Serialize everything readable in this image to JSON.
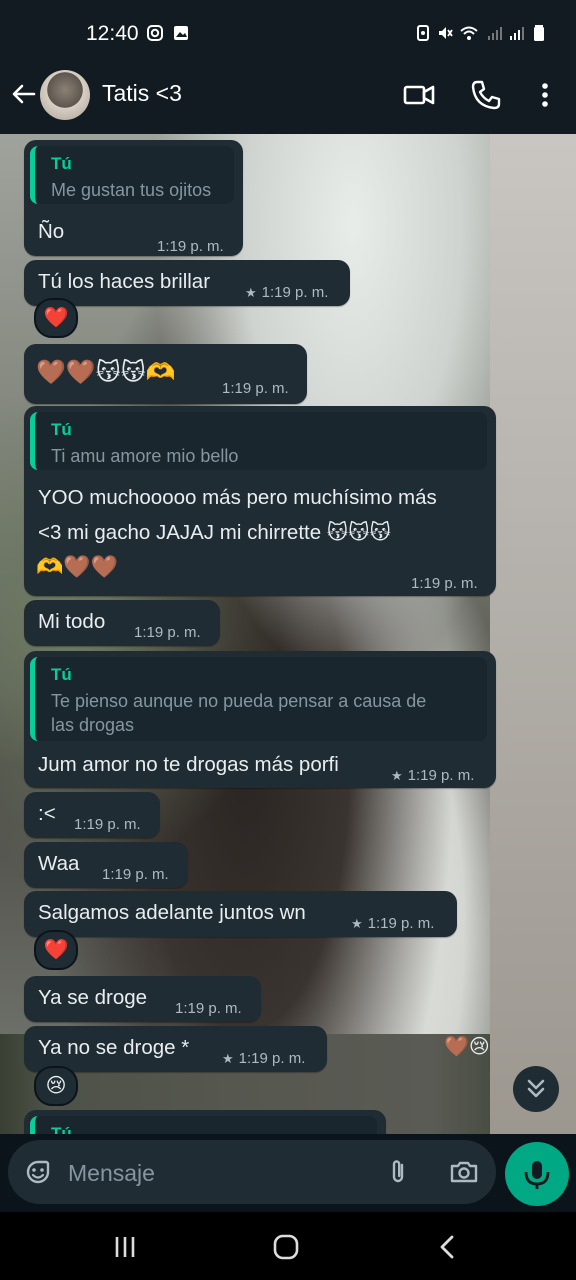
{
  "status": {
    "time": "12:40"
  },
  "header": {
    "contact_name": "Tatis <3"
  },
  "messages": [
    {
      "quote_author": "Tú",
      "quote_text": "Me gustan tus ojitos",
      "text": "Ño",
      "time": "1:19 p. m."
    },
    {
      "text": "Tú los haces brillar",
      "time": "1:19 p. m.",
      "starred": true,
      "reaction": "❤️"
    },
    {
      "text": "🤎🤎😽😽🫶",
      "time": "1:19 p. m."
    },
    {
      "quote_author": "Tú",
      "quote_text": "Ti amu amore mio bello",
      "text_lines": [
        "YOO muchooooo más pero muchísimo más",
        "<3 mi gacho JAJAJ mi chirrette 😽😽😽",
        "🫶🤎🤎"
      ],
      "time": "1:19 p. m."
    },
    {
      "text": "Mi todo",
      "time": "1:19 p. m."
    },
    {
      "quote_author": "Tú",
      "quote_text_lines": [
        "Te pienso aunque no pueda pensar a causa de",
        "las drogas"
      ],
      "text": "Jum amor no te drogas más porfi",
      "time": "1:19 p. m.",
      "starred": true
    },
    {
      "text": ":<",
      "time": "1:19 p. m."
    },
    {
      "text": "Waa",
      "time": "1:19 p. m."
    },
    {
      "text": "Salgamos adelante juntos wn",
      "time": "1:19 p. m.",
      "starred": true,
      "reaction": "❤️"
    },
    {
      "text": "Ya se droge",
      "time": "1:19 p. m."
    },
    {
      "text": "Ya no se droge *",
      "time": "1:19 p. m.",
      "starred": true,
      "reaction": "😢"
    },
    {
      "quote_author": "Tú"
    }
  ],
  "floating_reaction": "🤎😢",
  "input": {
    "placeholder": "Mensaje"
  },
  "colors": {
    "accent": "#06cf9c",
    "mic": "#00a884",
    "bubble": "#1f2c34",
    "bar": "#111b21"
  }
}
